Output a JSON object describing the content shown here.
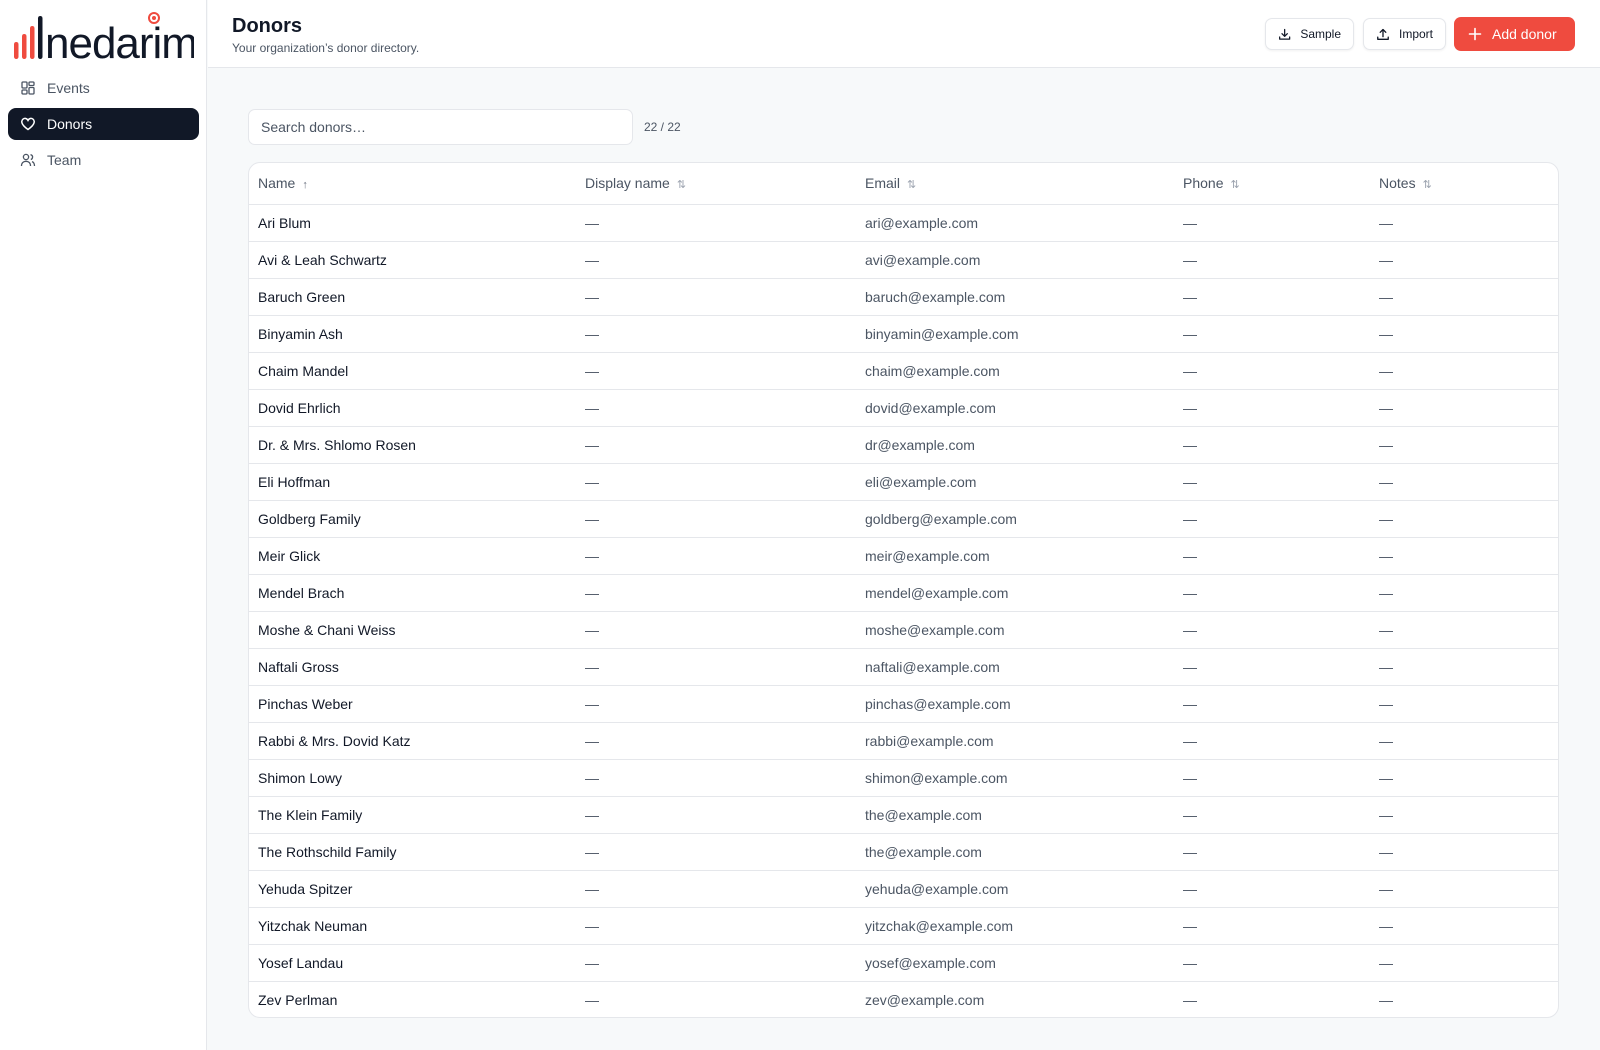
{
  "brand": {
    "name": "nedarim",
    "accent": "#ef4b3f"
  },
  "sidebar": {
    "items": [
      {
        "label": "Events",
        "icon": "grid-icon"
      },
      {
        "label": "Donors",
        "icon": "heart-icon",
        "active": true
      },
      {
        "label": "Team",
        "icon": "users-icon"
      }
    ]
  },
  "header": {
    "title": "Donors",
    "subtitle": "Your organization’s donor directory.",
    "sample_label": "Sample",
    "import_label": "Import",
    "add_label": "Add donor"
  },
  "search": {
    "placeholder": "Search donors…",
    "value": "",
    "count": "22 / 22"
  },
  "table": {
    "columns": [
      {
        "label": "Name",
        "sort": "↑"
      },
      {
        "label": "Display name",
        "sort": "⇅"
      },
      {
        "label": "Email",
        "sort": "⇅"
      },
      {
        "label": "Phone",
        "sort": "⇅"
      },
      {
        "label": "Notes",
        "sort": "⇅"
      }
    ],
    "rows": [
      {
        "name": "Ari Blum",
        "display": "—",
        "email": "ari@example.com",
        "phone": "—",
        "notes": "—"
      },
      {
        "name": "Avi & Leah Schwartz",
        "display": "—",
        "email": "avi@example.com",
        "phone": "—",
        "notes": "—"
      },
      {
        "name": "Baruch Green",
        "display": "—",
        "email": "baruch@example.com",
        "phone": "—",
        "notes": "—"
      },
      {
        "name": "Binyamin Ash",
        "display": "—",
        "email": "binyamin@example.com",
        "phone": "—",
        "notes": "—"
      },
      {
        "name": "Chaim Mandel",
        "display": "—",
        "email": "chaim@example.com",
        "phone": "—",
        "notes": "—"
      },
      {
        "name": "Dovid Ehrlich",
        "display": "—",
        "email": "dovid@example.com",
        "phone": "—",
        "notes": "—"
      },
      {
        "name": "Dr. & Mrs. Shlomo Rosen",
        "display": "—",
        "email": "dr@example.com",
        "phone": "—",
        "notes": "—"
      },
      {
        "name": "Eli Hoffman",
        "display": "—",
        "email": "eli@example.com",
        "phone": "—",
        "notes": "—"
      },
      {
        "name": "Goldberg Family",
        "display": "—",
        "email": "goldberg@example.com",
        "phone": "—",
        "notes": "—"
      },
      {
        "name": "Meir Glick",
        "display": "—",
        "email": "meir@example.com",
        "phone": "—",
        "notes": "—"
      },
      {
        "name": "Mendel Brach",
        "display": "—",
        "email": "mendel@example.com",
        "phone": "—",
        "notes": "—"
      },
      {
        "name": "Moshe & Chani Weiss",
        "display": "—",
        "email": "moshe@example.com",
        "phone": "—",
        "notes": "—"
      },
      {
        "name": "Naftali Gross",
        "display": "—",
        "email": "naftali@example.com",
        "phone": "—",
        "notes": "—"
      },
      {
        "name": "Pinchas Weber",
        "display": "—",
        "email": "pinchas@example.com",
        "phone": "—",
        "notes": "—"
      },
      {
        "name": "Rabbi & Mrs. Dovid Katz",
        "display": "—",
        "email": "rabbi@example.com",
        "phone": "—",
        "notes": "—"
      },
      {
        "name": "Shimon Lowy",
        "display": "—",
        "email": "shimon@example.com",
        "phone": "—",
        "notes": "—"
      },
      {
        "name": "The Klein Family",
        "display": "—",
        "email": "the@example.com",
        "phone": "—",
        "notes": "—"
      },
      {
        "name": "The Rothschild Family",
        "display": "—",
        "email": "the@example.com",
        "phone": "—",
        "notes": "—"
      },
      {
        "name": "Yehuda Spitzer",
        "display": "—",
        "email": "yehuda@example.com",
        "phone": "—",
        "notes": "—"
      },
      {
        "name": "Yitzchak Neuman",
        "display": "—",
        "email": "yitzchak@example.com",
        "phone": "—",
        "notes": "—"
      },
      {
        "name": "Yosef Landau",
        "display": "—",
        "email": "yosef@example.com",
        "phone": "—",
        "notes": "—"
      },
      {
        "name": "Zev Perlman",
        "display": "—",
        "email": "zev@example.com",
        "phone": "—",
        "notes": "—"
      }
    ]
  }
}
